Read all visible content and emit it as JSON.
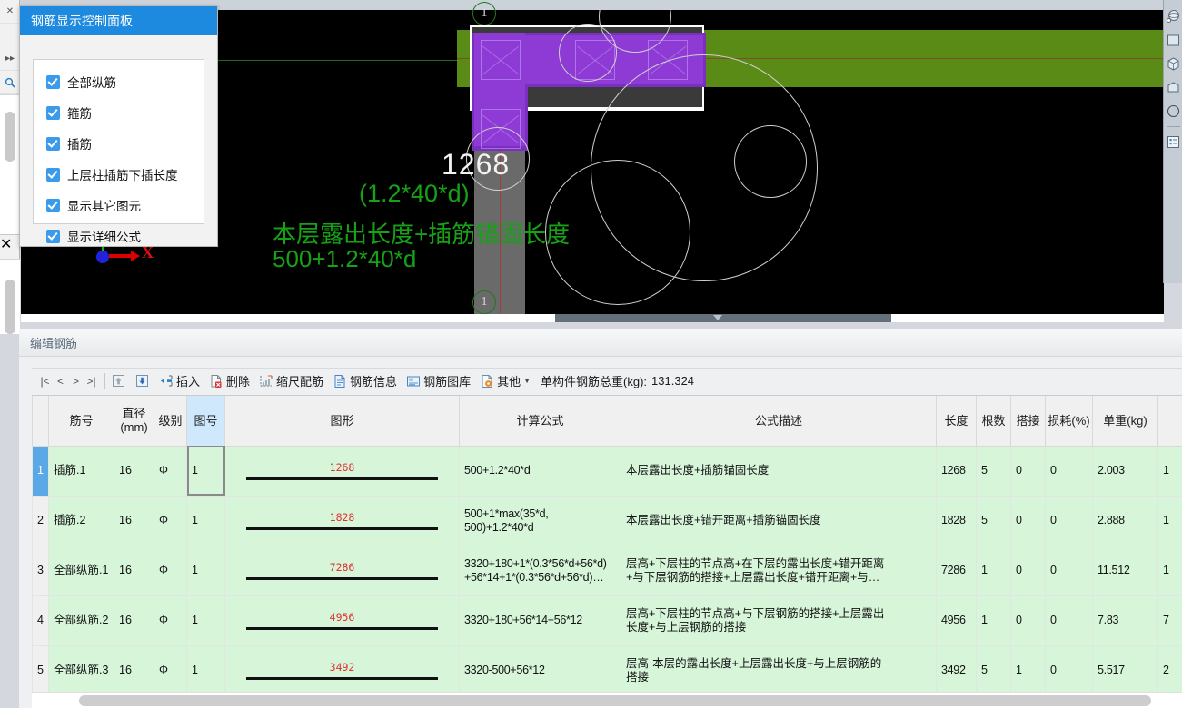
{
  "left_toolstrip": {
    "buttons": [
      {
        "name": "close-icon",
        "glyph": "✕"
      },
      {
        "name": "expand-right-icon",
        "glyph": "▸▸"
      },
      {
        "name": "search-icon",
        "glyph": "🔍"
      }
    ],
    "second_close_glyph": "✕"
  },
  "panel": {
    "title": "钢筋显示控制面板",
    "options": [
      {
        "label": "全部纵筋",
        "checked": true
      },
      {
        "label": "箍筋",
        "checked": true
      },
      {
        "label": "插筋",
        "checked": true
      },
      {
        "label": "上层柱插筋下插长度",
        "checked": true
      },
      {
        "label": "显示其它图元",
        "checked": true
      },
      {
        "label": "显示详细公式",
        "checked": true
      }
    ]
  },
  "viewport": {
    "dimension_label": "1268",
    "annotation_line1": "(1.2*40*d)",
    "annotation_line2": "本层露出长度+插筋锚固长度",
    "annotation_line3": "500+1.2*40*d",
    "tag_top": "1",
    "tag_bottom": "1",
    "axis_label": "X",
    "colors": {
      "background": "#000000",
      "column": "#8e3ad4",
      "beam": "#5b8b17",
      "annotation_text": "#16a116",
      "axis_x": "#e01010"
    }
  },
  "right_toolbar": {
    "icons": [
      {
        "name": "orbit-3d-icon"
      },
      {
        "name": "front-view-icon"
      },
      {
        "name": "isometric-cube-icon"
      },
      {
        "name": "top-view-icon"
      },
      {
        "name": "circle-view-icon"
      },
      {
        "name": "properties-list-icon"
      }
    ]
  },
  "editor": {
    "title": "编辑钢筋",
    "toolbar": {
      "nav": [
        "|<",
        "<",
        ">",
        ">|"
      ],
      "move_up": "move-up-icon",
      "move_down": "move-down-icon",
      "items": [
        {
          "icon": "insert-icon",
          "label": "插入"
        },
        {
          "icon": "delete-icon",
          "label": "删除"
        },
        {
          "icon": "scale-rebar-icon",
          "label": "缩尺配筋"
        },
        {
          "icon": "rebar-info-icon",
          "label": "钢筋信息"
        },
        {
          "icon": "rebar-library-icon",
          "label": "钢筋图库"
        },
        {
          "icon": "other-icon",
          "label": "其他",
          "has_caret": true
        }
      ],
      "total_label": "单构件钢筋总重(kg):",
      "total_value": "131.324"
    },
    "columns": [
      {
        "key": "num",
        "label": ""
      },
      {
        "key": "rebar_name",
        "label": "筋号"
      },
      {
        "key": "diameter",
        "label": "直径(mm)"
      },
      {
        "key": "grade",
        "label": "级别"
      },
      {
        "key": "fig_no",
        "label": "图号",
        "selected": true
      },
      {
        "key": "shape",
        "label": "图形"
      },
      {
        "key": "formula",
        "label": "计算公式"
      },
      {
        "key": "formula_desc",
        "label": "公式描述"
      },
      {
        "key": "length",
        "label": "长度"
      },
      {
        "key": "count",
        "label": "根数"
      },
      {
        "key": "lap",
        "label": "搭接"
      },
      {
        "key": "loss",
        "label": "损耗(%)"
      },
      {
        "key": "unit_weight",
        "label": "单重(kg)"
      },
      {
        "key": "total_weight",
        "label": ""
      }
    ],
    "rows": [
      {
        "num": "1",
        "rebar_name": "插筋.1",
        "diameter": "16",
        "grade": "Φ",
        "fig_no": "1",
        "shape_value": "1268",
        "formula": "500+1.2*40*d",
        "formula_desc": "本层露出长度+插筋锚固长度",
        "length": "1268",
        "count": "5",
        "lap": "0",
        "loss": "0",
        "unit_weight": "2.003",
        "total_weight": "1",
        "active": true
      },
      {
        "num": "2",
        "rebar_name": "插筋.2",
        "diameter": "16",
        "grade": "Φ",
        "fig_no": "1",
        "shape_value": "1828",
        "formula": "500+1*max(35*d,\n500)+1.2*40*d",
        "formula_desc": "本层露出长度+错开距离+插筋锚固长度",
        "length": "1828",
        "count": "5",
        "lap": "0",
        "loss": "0",
        "unit_weight": "2.888",
        "total_weight": "1",
        "active": false
      },
      {
        "num": "3",
        "rebar_name": "全部纵筋.1",
        "diameter": "16",
        "grade": "Φ",
        "fig_no": "1",
        "shape_value": "7286",
        "formula": "3320+180+1*(0.3*56*d+56*d)\n+56*14+1*(0.3*56*d+56*d)…",
        "formula_desc": "层高+下层柱的节点高+在下层的露出长度+错开距离\n+与下层钢筋的搭接+上层露出长度+错开距离+与…",
        "length": "7286",
        "count": "1",
        "lap": "0",
        "loss": "0",
        "unit_weight": "11.512",
        "total_weight": "1",
        "active": false
      },
      {
        "num": "4",
        "rebar_name": "全部纵筋.2",
        "diameter": "16",
        "grade": "Φ",
        "fig_no": "1",
        "shape_value": "4956",
        "formula": "3320+180+56*14+56*12",
        "formula_desc": "层高+下层柱的节点高+与下层钢筋的搭接+上层露出\n长度+与上层钢筋的搭接",
        "length": "4956",
        "count": "1",
        "lap": "0",
        "loss": "0",
        "unit_weight": "7.83",
        "total_weight": "7",
        "active": false
      },
      {
        "num": "5",
        "rebar_name": "全部纵筋.3",
        "diameter": "16",
        "grade": "Φ",
        "fig_no": "1",
        "shape_value": "3492",
        "formula": "3320-500+56*12",
        "formula_desc": "层高-本层的露出长度+上层露出长度+与上层钢筋的\n搭接",
        "length": "3492",
        "count": "5",
        "lap": "1",
        "loss": "0",
        "unit_weight": "5.517",
        "total_weight": "2",
        "active": false
      }
    ]
  }
}
